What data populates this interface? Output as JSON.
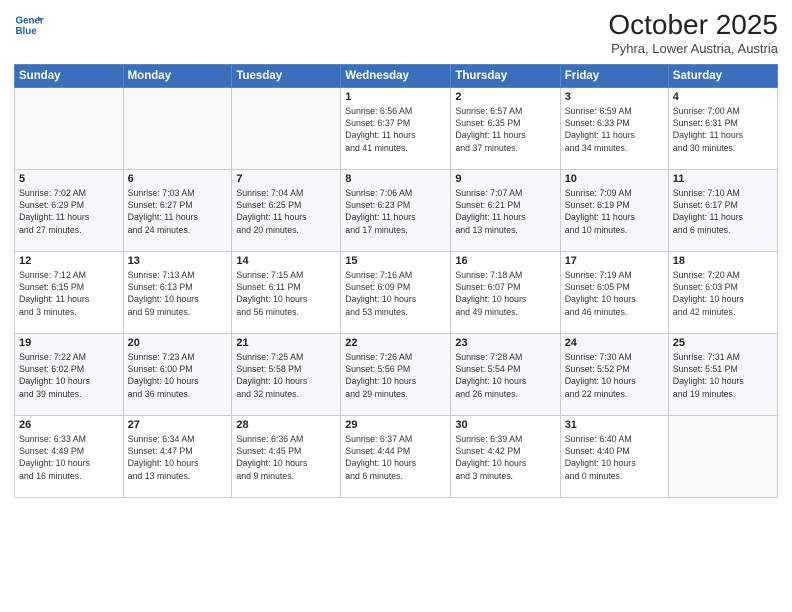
{
  "logo": {
    "line1": "General",
    "line2": "Blue"
  },
  "header": {
    "month": "October 2025",
    "location": "Pyhra, Lower Austria, Austria"
  },
  "weekdays": [
    "Sunday",
    "Monday",
    "Tuesday",
    "Wednesday",
    "Thursday",
    "Friday",
    "Saturday"
  ],
  "weeks": [
    [
      {
        "day": "",
        "info": ""
      },
      {
        "day": "",
        "info": ""
      },
      {
        "day": "",
        "info": ""
      },
      {
        "day": "1",
        "info": "Sunrise: 6:56 AM\nSunset: 6:37 PM\nDaylight: 11 hours\nand 41 minutes."
      },
      {
        "day": "2",
        "info": "Sunrise: 6:57 AM\nSunset: 6:35 PM\nDaylight: 11 hours\nand 37 minutes."
      },
      {
        "day": "3",
        "info": "Sunrise: 6:59 AM\nSunset: 6:33 PM\nDaylight: 11 hours\nand 34 minutes."
      },
      {
        "day": "4",
        "info": "Sunrise: 7:00 AM\nSunset: 6:31 PM\nDaylight: 11 hours\nand 30 minutes."
      }
    ],
    [
      {
        "day": "5",
        "info": "Sunrise: 7:02 AM\nSunset: 6:29 PM\nDaylight: 11 hours\nand 27 minutes."
      },
      {
        "day": "6",
        "info": "Sunrise: 7:03 AM\nSunset: 6:27 PM\nDaylight: 11 hours\nand 24 minutes."
      },
      {
        "day": "7",
        "info": "Sunrise: 7:04 AM\nSunset: 6:25 PM\nDaylight: 11 hours\nand 20 minutes."
      },
      {
        "day": "8",
        "info": "Sunrise: 7:06 AM\nSunset: 6:23 PM\nDaylight: 11 hours\nand 17 minutes."
      },
      {
        "day": "9",
        "info": "Sunrise: 7:07 AM\nSunset: 6:21 PM\nDaylight: 11 hours\nand 13 minutes."
      },
      {
        "day": "10",
        "info": "Sunrise: 7:09 AM\nSunset: 6:19 PM\nDaylight: 11 hours\nand 10 minutes."
      },
      {
        "day": "11",
        "info": "Sunrise: 7:10 AM\nSunset: 6:17 PM\nDaylight: 11 hours\nand 6 minutes."
      }
    ],
    [
      {
        "day": "12",
        "info": "Sunrise: 7:12 AM\nSunset: 6:15 PM\nDaylight: 11 hours\nand 3 minutes."
      },
      {
        "day": "13",
        "info": "Sunrise: 7:13 AM\nSunset: 6:13 PM\nDaylight: 10 hours\nand 59 minutes."
      },
      {
        "day": "14",
        "info": "Sunrise: 7:15 AM\nSunset: 6:11 PM\nDaylight: 10 hours\nand 56 minutes."
      },
      {
        "day": "15",
        "info": "Sunrise: 7:16 AM\nSunset: 6:09 PM\nDaylight: 10 hours\nand 53 minutes."
      },
      {
        "day": "16",
        "info": "Sunrise: 7:18 AM\nSunset: 6:07 PM\nDaylight: 10 hours\nand 49 minutes."
      },
      {
        "day": "17",
        "info": "Sunrise: 7:19 AM\nSunset: 6:05 PM\nDaylight: 10 hours\nand 46 minutes."
      },
      {
        "day": "18",
        "info": "Sunrise: 7:20 AM\nSunset: 6:03 PM\nDaylight: 10 hours\nand 42 minutes."
      }
    ],
    [
      {
        "day": "19",
        "info": "Sunrise: 7:22 AM\nSunset: 6:02 PM\nDaylight: 10 hours\nand 39 minutes."
      },
      {
        "day": "20",
        "info": "Sunrise: 7:23 AM\nSunset: 6:00 PM\nDaylight: 10 hours\nand 36 minutes."
      },
      {
        "day": "21",
        "info": "Sunrise: 7:25 AM\nSunset: 5:58 PM\nDaylight: 10 hours\nand 32 minutes."
      },
      {
        "day": "22",
        "info": "Sunrise: 7:26 AM\nSunset: 5:56 PM\nDaylight: 10 hours\nand 29 minutes."
      },
      {
        "day": "23",
        "info": "Sunrise: 7:28 AM\nSunset: 5:54 PM\nDaylight: 10 hours\nand 26 minutes."
      },
      {
        "day": "24",
        "info": "Sunrise: 7:30 AM\nSunset: 5:52 PM\nDaylight: 10 hours\nand 22 minutes."
      },
      {
        "day": "25",
        "info": "Sunrise: 7:31 AM\nSunset: 5:51 PM\nDaylight: 10 hours\nand 19 minutes."
      }
    ],
    [
      {
        "day": "26",
        "info": "Sunrise: 6:33 AM\nSunset: 4:49 PM\nDaylight: 10 hours\nand 16 minutes."
      },
      {
        "day": "27",
        "info": "Sunrise: 6:34 AM\nSunset: 4:47 PM\nDaylight: 10 hours\nand 13 minutes."
      },
      {
        "day": "28",
        "info": "Sunrise: 6:36 AM\nSunset: 4:45 PM\nDaylight: 10 hours\nand 9 minutes."
      },
      {
        "day": "29",
        "info": "Sunrise: 6:37 AM\nSunset: 4:44 PM\nDaylight: 10 hours\nand 6 minutes."
      },
      {
        "day": "30",
        "info": "Sunrise: 6:39 AM\nSunset: 4:42 PM\nDaylight: 10 hours\nand 3 minutes."
      },
      {
        "day": "31",
        "info": "Sunrise: 6:40 AM\nSunset: 4:40 PM\nDaylight: 10 hours\nand 0 minutes."
      },
      {
        "day": "",
        "info": ""
      }
    ]
  ]
}
